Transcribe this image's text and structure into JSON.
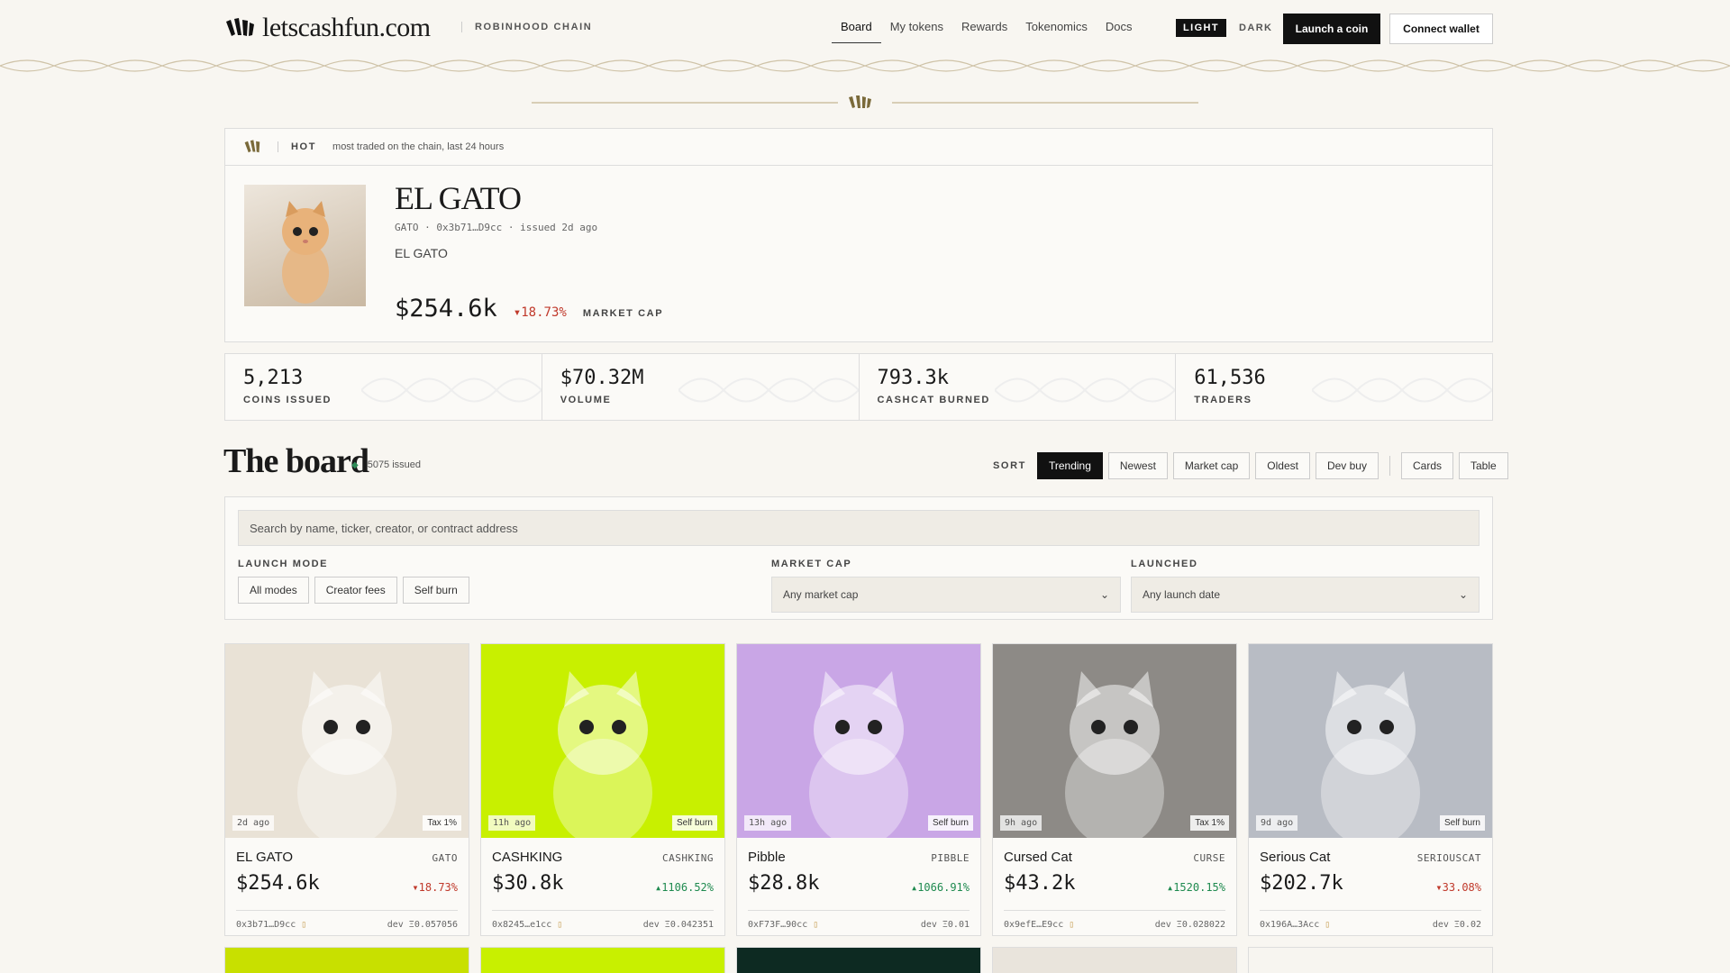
{
  "brand": {
    "name": "letscashfun.com",
    "chain": "ROBINHOOD CHAIN"
  },
  "nav": [
    {
      "label": "Board"
    },
    {
      "label": "My tokens"
    },
    {
      "label": "Rewards"
    },
    {
      "label": "Tokenomics"
    },
    {
      "label": "Docs"
    }
  ],
  "theme": {
    "light": "LIGHT",
    "dark": "DARK"
  },
  "actions": {
    "launch": "Launch a coin",
    "connect": "Connect wallet"
  },
  "hot": {
    "label": "HOT",
    "subtitle": "most traded on the chain, last 24 hours",
    "name": "EL GATO",
    "meta": "GATO · 0x3b71…D9cc · issued 2d ago",
    "description": "EL GATO",
    "market_cap": "$254.6k",
    "change": "▾18.73%",
    "cap_label": "MARKET CAP"
  },
  "stats": [
    {
      "value": "5,213",
      "label": "COINS ISSUED"
    },
    {
      "value": "$70.32M",
      "label": "VOLUME"
    },
    {
      "value": "793.3k",
      "label": "CASHCAT BURNED"
    },
    {
      "value": "61,536",
      "label": "TRADERS"
    }
  ],
  "board": {
    "title": "The board",
    "count": "5075 issued",
    "sort_label": "SORT"
  },
  "sort_options": [
    "Trending",
    "Newest",
    "Market cap",
    "Oldest",
    "Dev buy"
  ],
  "view_options": [
    "Cards",
    "Table"
  ],
  "filters": {
    "search_placeholder": "Search by name, ticker, creator, or contract address",
    "launch_mode_label": "LAUNCH MODE",
    "launch_modes": [
      "All modes",
      "Creator fees",
      "Self burn"
    ],
    "market_cap_label": "MARKET CAP",
    "market_cap_value": "Any market cap",
    "launched_label": "LAUNCHED",
    "launched_value": "Any launch date"
  },
  "cards": [
    {
      "name": "EL GATO",
      "ticker": "GATO",
      "cap": "$254.6k",
      "change": "▾18.73%",
      "dir": "down",
      "age": "2d ago",
      "mode": "Tax 1%",
      "address": "0x3b71…D9cc",
      "dev": "dev Ξ0.057056",
      "bg": "#e9e2d6"
    },
    {
      "name": "CASHKING",
      "ticker": "CASHKING",
      "cap": "$30.8k",
      "change": "▴1106.52%",
      "dir": "up",
      "age": "11h ago",
      "mode": "Self burn",
      "address": "0x8245…e1cc",
      "dev": "dev Ξ0.042351",
      "bg": "#c8f000"
    },
    {
      "name": "Pibble",
      "ticker": "PIBBLE",
      "cap": "$28.8k",
      "change": "▴1066.91%",
      "dir": "up",
      "age": "13h ago",
      "mode": "Self burn",
      "address": "0xF73F…90cc",
      "dev": "dev Ξ0.01",
      "bg": "#c9a6e6"
    },
    {
      "name": "Cursed Cat",
      "ticker": "CURSE",
      "cap": "$43.2k",
      "change": "▴1520.15%",
      "dir": "up",
      "age": "9h ago",
      "mode": "Tax 1%",
      "address": "0x9efE…E9cc",
      "dev": "dev Ξ0.028022",
      "bg": "#8d8a86"
    },
    {
      "name": "Serious Cat",
      "ticker": "SERIOUSCAT",
      "cap": "$202.7k",
      "change": "▾33.08%",
      "dir": "down",
      "age": "9d ago",
      "mode": "Self burn",
      "address": "0x196A…3Acc",
      "dev": "dev Ξ0.02",
      "bg": "#b8bcc4"
    }
  ],
  "row2_colors": [
    "#c8e000",
    "#c8f000",
    "#0d2a22",
    "#e9e4dc",
    "#f7f5f0"
  ]
}
